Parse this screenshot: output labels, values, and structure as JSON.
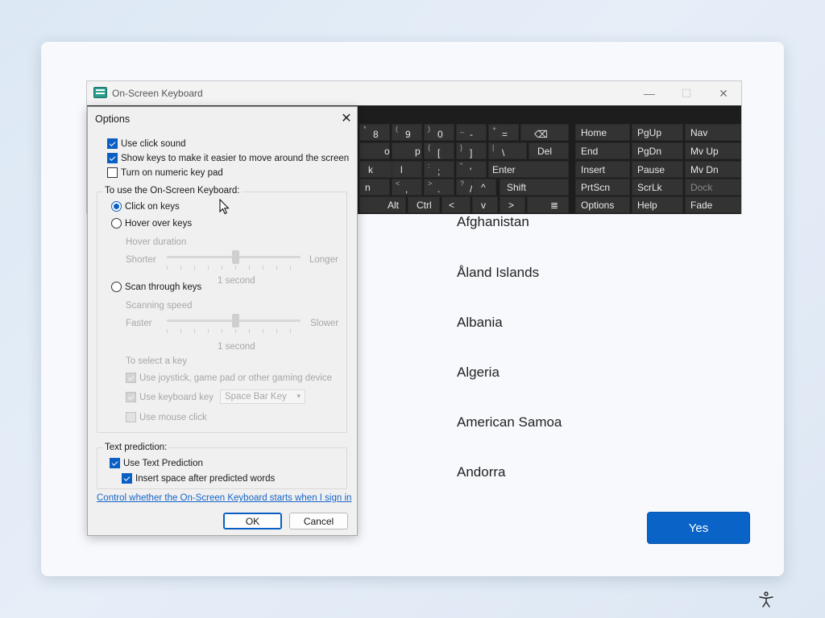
{
  "setup": {
    "countries": [
      "Afghanistan",
      "Åland Islands",
      "Albania",
      "Algeria",
      "American Samoa",
      "Andorra"
    ],
    "yes_label": "Yes",
    "accessibility_icon": "accessibility-icon"
  },
  "osk": {
    "title": "On-Screen Keyboard",
    "window_buttons": {
      "minimize": "—",
      "maximize": "☐",
      "close": "✕"
    },
    "keys": {
      "row1": [
        {
          "top": "*",
          "label": "8"
        },
        {
          "top": "(",
          "label": "9"
        },
        {
          "top": ")",
          "label": "0"
        },
        {
          "top": "_",
          "label": "-"
        },
        {
          "top": "+",
          "label": "="
        },
        {
          "top": "",
          "label": "⌫"
        }
      ],
      "row2": [
        "o",
        "p",
        "[",
        "]",
        "\\",
        "Del"
      ],
      "row2_top": [
        "",
        "",
        "{",
        "}",
        "|",
        ""
      ],
      "row3": [
        "k",
        "l",
        ";",
        "'",
        "Enter"
      ],
      "row3_top": [
        "",
        "",
        ":",
        "\"",
        ""
      ],
      "row4": [
        "n",
        ",",
        ".",
        "/",
        "^",
        "Shift"
      ],
      "row4_top": [
        "",
        "<",
        ">",
        "?",
        "",
        ""
      ],
      "row5": [
        "Alt",
        "Ctrl",
        "<",
        "v",
        ">",
        "≣"
      ],
      "nav_col1": [
        "Home",
        "End",
        "Insert",
        "PrtScn",
        "Options"
      ],
      "nav_col2": [
        "PgUp",
        "PgDn",
        "Pause",
        "ScrLk",
        "Help"
      ],
      "nav_col3": [
        "Nav",
        "Mv Up",
        "Mv Dn",
        "Dock",
        "Fade"
      ]
    }
  },
  "options": {
    "title": "Options",
    "close": "✕",
    "use_click_sound": "Use click sound",
    "show_keys": "Show keys to make it easier to move around the screen",
    "numeric_pad": "Turn on numeric key pad",
    "use_group_label": "To use the On-Screen Keyboard:",
    "click_on_keys": "Click on keys",
    "hover_over_keys": "Hover over keys",
    "hover_duration": "Hover duration",
    "shorter": "Shorter",
    "longer": "Longer",
    "hover_value": "1 second",
    "scan_through_keys": "Scan through keys",
    "scanning_speed": "Scanning speed",
    "faster": "Faster",
    "slower": "Slower",
    "scan_value": "1 second",
    "to_select_key": "To select a key",
    "use_joystick": "Use joystick, game pad or other gaming device",
    "use_keyboard_key": "Use keyboard key",
    "keyboard_key_value": "Space Bar Key",
    "use_mouse_click": "Use mouse click",
    "text_prediction_label": "Text prediction:",
    "use_text_prediction": "Use Text Prediction",
    "insert_space": "Insert space after predicted words",
    "control_link": "Control whether the On-Screen Keyboard starts when I sign in",
    "ok_label": "OK",
    "cancel_label": "Cancel"
  }
}
